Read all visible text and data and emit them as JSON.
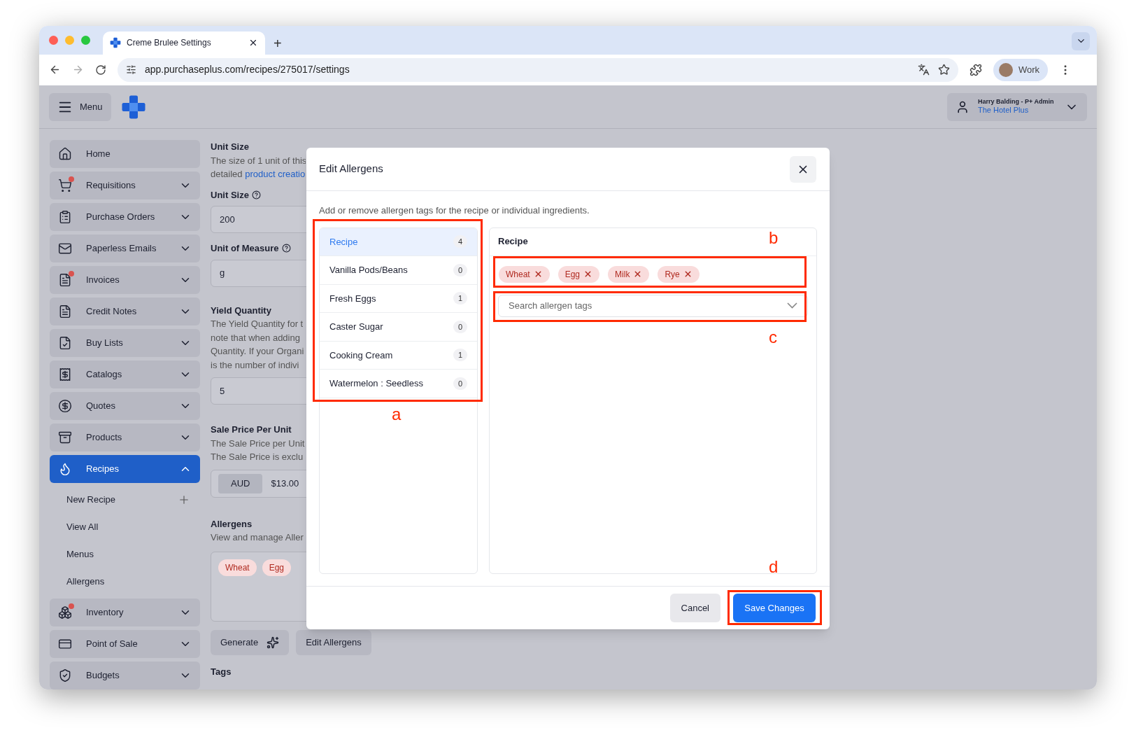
{
  "browser": {
    "tab_title": "Creme Brulee Settings",
    "new_tab": "+",
    "url": "app.purchaseplus.com/recipes/275017/settings",
    "profile": "Work"
  },
  "header": {
    "menu_label": "Menu",
    "user_name": "Harry Balding - P+ Admin",
    "organisation": "The Hotel Plus"
  },
  "sidebar": {
    "items": [
      {
        "label": "Home",
        "kind": "link",
        "notification": false,
        "selected": false
      },
      {
        "label": "Requisitions",
        "kind": "group",
        "notification": true,
        "selected": false,
        "expanded": false
      },
      {
        "label": "Purchase Orders",
        "kind": "group",
        "notification": false,
        "selected": false,
        "expanded": false
      },
      {
        "label": "Paperless Emails",
        "kind": "group",
        "notification": false,
        "selected": false,
        "expanded": false
      },
      {
        "label": "Invoices",
        "kind": "group",
        "notification": true,
        "selected": false,
        "expanded": false
      },
      {
        "label": "Credit Notes",
        "kind": "group",
        "notification": false,
        "selected": false,
        "expanded": false
      },
      {
        "label": "Buy Lists",
        "kind": "group",
        "notification": false,
        "selected": false,
        "expanded": false
      },
      {
        "label": "Catalogs",
        "kind": "group",
        "notification": false,
        "selected": false,
        "expanded": false
      },
      {
        "label": "Quotes",
        "kind": "group",
        "notification": false,
        "selected": false,
        "expanded": false
      },
      {
        "label": "Products",
        "kind": "group",
        "notification": false,
        "selected": false,
        "expanded": false
      },
      {
        "label": "Recipes",
        "kind": "group",
        "notification": false,
        "selected": true,
        "expanded": true,
        "children": [
          {
            "label": "New Recipe",
            "kind": "add"
          },
          {
            "label": "View All",
            "kind": "link"
          },
          {
            "label": "Menus",
            "kind": "link"
          },
          {
            "label": "Allergens",
            "kind": "link"
          }
        ]
      },
      {
        "label": "Inventory",
        "kind": "group",
        "notification": true,
        "selected": false,
        "expanded": false
      },
      {
        "label": "Point of Sale",
        "kind": "group",
        "notification": false,
        "selected": false,
        "expanded": false
      },
      {
        "label": "Budgets",
        "kind": "group",
        "notification": false,
        "selected": false,
        "expanded": false
      }
    ]
  },
  "form": {
    "unit_size_section": {
      "title": "Unit Size",
      "line_1": "The size of 1 unit of this",
      "line_2": "detailed",
      "link": "product creatio"
    },
    "unit_size": {
      "label": "Unit Size",
      "value": "200"
    },
    "unit_of_measure": {
      "label": "Unit of Measure",
      "value": "g"
    },
    "yield_quantity": {
      "title": "Yield Quantity",
      "lines": [
        "The Yield Quantity for t",
        "note that when adding",
        "Quantity. If your Organi",
        "is the number of indivi"
      ],
      "value": "5"
    },
    "sale_price": {
      "title": "Sale Price Per Unit",
      "lines": [
        "The Sale Price per Unit",
        "The Sale Price is exclu"
      ],
      "currency": "AUD",
      "value": "$13.00"
    },
    "allergens": {
      "title": "Allergens",
      "description": "View and manage Aller",
      "tags": [
        "Wheat",
        "Egg"
      ]
    },
    "buttons": [
      "Generate",
      "Edit Allergens"
    ],
    "tags_title": "Tags"
  },
  "modal": {
    "title": "Edit Allergens",
    "description": "Add or remove allergen tags for the recipe or individual ingredients.",
    "list": [
      {
        "label": "Recipe",
        "count": "4",
        "selected": true
      },
      {
        "label": "Vanilla Pods/Beans",
        "count": "0",
        "selected": false
      },
      {
        "label": "Fresh Eggs",
        "count": "1",
        "selected": false
      },
      {
        "label": "Caster Sugar",
        "count": "0",
        "selected": false
      },
      {
        "label": "Cooking Cream",
        "count": "1",
        "selected": false
      },
      {
        "label": "Watermelon : Seedless",
        "count": "0",
        "selected": false
      }
    ],
    "panel_title": "Recipe",
    "tags": [
      "Wheat",
      "Egg",
      "Milk",
      "Rye"
    ],
    "search": {
      "placeholder": "Search allergen tags"
    },
    "cancel": "Cancel",
    "save": "Save Changes"
  },
  "annotations": [
    {
      "label": "a"
    },
    {
      "label": "b"
    },
    {
      "label": "c"
    },
    {
      "label": "d"
    }
  ]
}
